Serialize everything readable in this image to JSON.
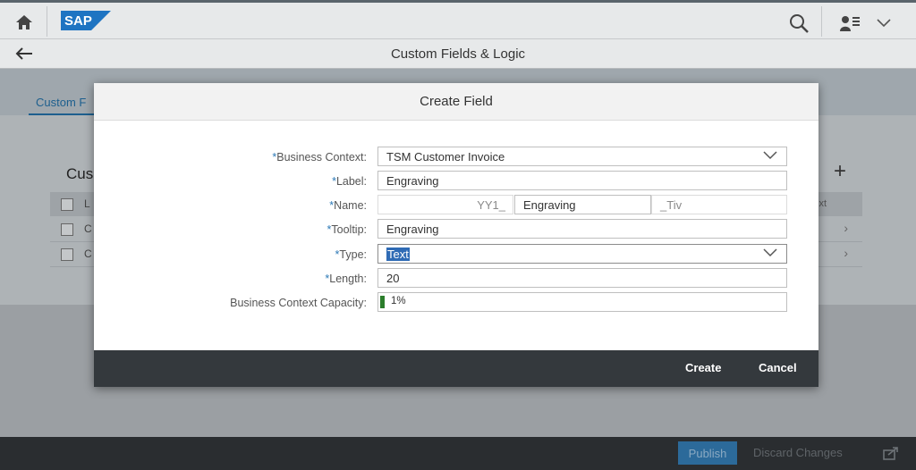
{
  "shell": {
    "logo_text": "SAP",
    "home_icon": "home-icon",
    "search_icon": "search-icon",
    "user_icon": "user-icon"
  },
  "subheader": {
    "title": "Custom Fields & Logic"
  },
  "background": {
    "tab_label": "Custom F",
    "section_title": "Cus",
    "add_symbol": "+",
    "header_col_text": "xt",
    "header_col_letter": "L",
    "row_letters": [
      "C",
      "C"
    ]
  },
  "dialog": {
    "title": "Create Field",
    "fields": {
      "business_context": {
        "label": "Business Context:",
        "value": "TSM Customer Invoice"
      },
      "label": {
        "label": "Label:",
        "value": "Engraving"
      },
      "name": {
        "label": "Name:",
        "prefix": "YY1_",
        "value": "Engraving",
        "suffix": "_Tiv"
      },
      "tooltip": {
        "label": "Tooltip:",
        "value": "Engraving"
      },
      "type": {
        "label": "Type:",
        "value": "Text"
      },
      "length": {
        "label": "Length:",
        "value": "20"
      },
      "capacity": {
        "label": "Business Context Capacity:",
        "value": "1%",
        "percent": 1
      }
    },
    "required_marker": "*",
    "create_label": "Create",
    "cancel_label": "Cancel"
  },
  "footer": {
    "publish_label": "Publish",
    "discard_label": "Discard Changes"
  },
  "colors": {
    "accent": "#2c79b6",
    "capacity_fill": "#2b7d2b",
    "dialog_footer": "#34393d"
  }
}
